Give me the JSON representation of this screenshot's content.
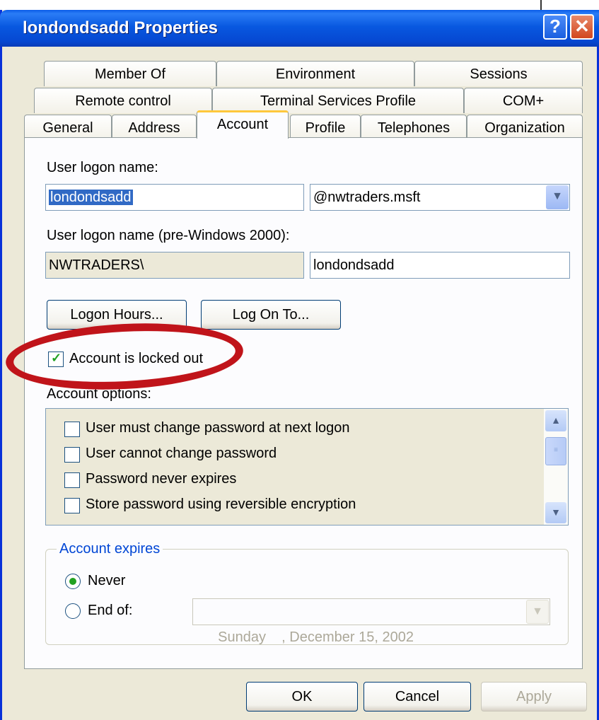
{
  "window": {
    "title": "londondsadd Properties",
    "help": "?",
    "close": "✕"
  },
  "tabs": {
    "row1": [
      "Member Of",
      "Environment",
      "Sessions"
    ],
    "row2": [
      "Remote control",
      "Terminal Services Profile",
      "COM+"
    ],
    "row3": [
      "General",
      "Address",
      "Account",
      "Profile",
      "Telephones",
      "Organization"
    ],
    "active": "Account"
  },
  "account": {
    "logon_label": "User logon name:",
    "logon_value": "londondsadd",
    "domain_value": "@nwtraders.msft",
    "pre2000_label": "User logon name (pre-Windows 2000):",
    "pre2000_domain": "NWTRADERS\\",
    "pre2000_name": "londondsadd",
    "logon_hours_btn": "Logon Hours...",
    "log_on_to_btn": "Log On To...",
    "locked_out_label": "Account is locked out",
    "locked_out_checked": true,
    "options_label": "Account options:",
    "options": [
      "User must change password at next logon",
      "User cannot change password",
      "Password never expires",
      "Store password using reversible encryption"
    ],
    "expires_label": "Account expires",
    "never_label": "Never",
    "end_of_label": "End of:",
    "end_of_date": "Sunday    , December 15, 2002",
    "expires_selected": "Never"
  },
  "buttons": {
    "ok": "OK",
    "cancel": "Cancel",
    "apply": "Apply"
  },
  "colors": {
    "titlebar": "#0858e0",
    "highlight": "#316ac5",
    "annotation": "#c0141a",
    "tab_active_top": "#ffc83c"
  }
}
